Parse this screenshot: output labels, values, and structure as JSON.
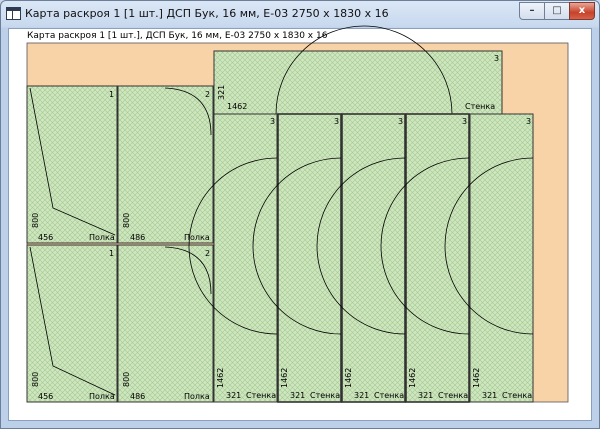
{
  "window": {
    "title": "Карта раскроя 1 [1 шт.] ДСП Бук, 16 мм, Е-03 2750 x 1830 x 16",
    "controls": {
      "minimize": "–",
      "maximize": "□",
      "close": "x"
    }
  },
  "sheet": {
    "caption": "Карта раскроя 1 [1 шт.], ДСП Бук, 16 мм, Е-03 2750 x 1830 x 16",
    "colors": {
      "waste": "#f9d3a8",
      "part": "#cfe6bf",
      "hatch": "#9ec38c",
      "outline": "#000000"
    }
  },
  "parts": [
    {
      "id": "p1a",
      "qty": "1",
      "width": "456",
      "length": "800",
      "name": "Полка",
      "shape": "notch"
    },
    {
      "id": "p1b",
      "qty": "1",
      "width": "456",
      "length": "800",
      "name": "Полка",
      "shape": "notch"
    },
    {
      "id": "p2a",
      "qty": "2",
      "width": "486",
      "length": "800",
      "name": "Полка",
      "shape": "round"
    },
    {
      "id": "p2b",
      "qty": "2",
      "width": "486",
      "length": "800",
      "name": "Полка",
      "shape": "round"
    },
    {
      "id": "p3t",
      "qty": "3",
      "width": "1462",
      "length": "321",
      "name": "Стенка",
      "shape": "arc-top"
    },
    {
      "id": "p3a",
      "qty": "3",
      "width": "321",
      "length": "1462",
      "name": "Стенка",
      "shape": "arc-left"
    },
    {
      "id": "p3b",
      "qty": "3",
      "width": "321",
      "length": "1462",
      "name": "Стенка",
      "shape": "arc-left"
    },
    {
      "id": "p3c",
      "qty": "3",
      "width": "321",
      "length": "1462",
      "name": "Стенка",
      "shape": "arc-left"
    },
    {
      "id": "p3d",
      "qty": "3",
      "width": "321",
      "length": "1462",
      "name": "Стенка",
      "shape": "arc-left"
    },
    {
      "id": "p3e",
      "qty": "3",
      "width": "321",
      "length": "1462",
      "name": "Стенка",
      "shape": "arc-left"
    }
  ]
}
